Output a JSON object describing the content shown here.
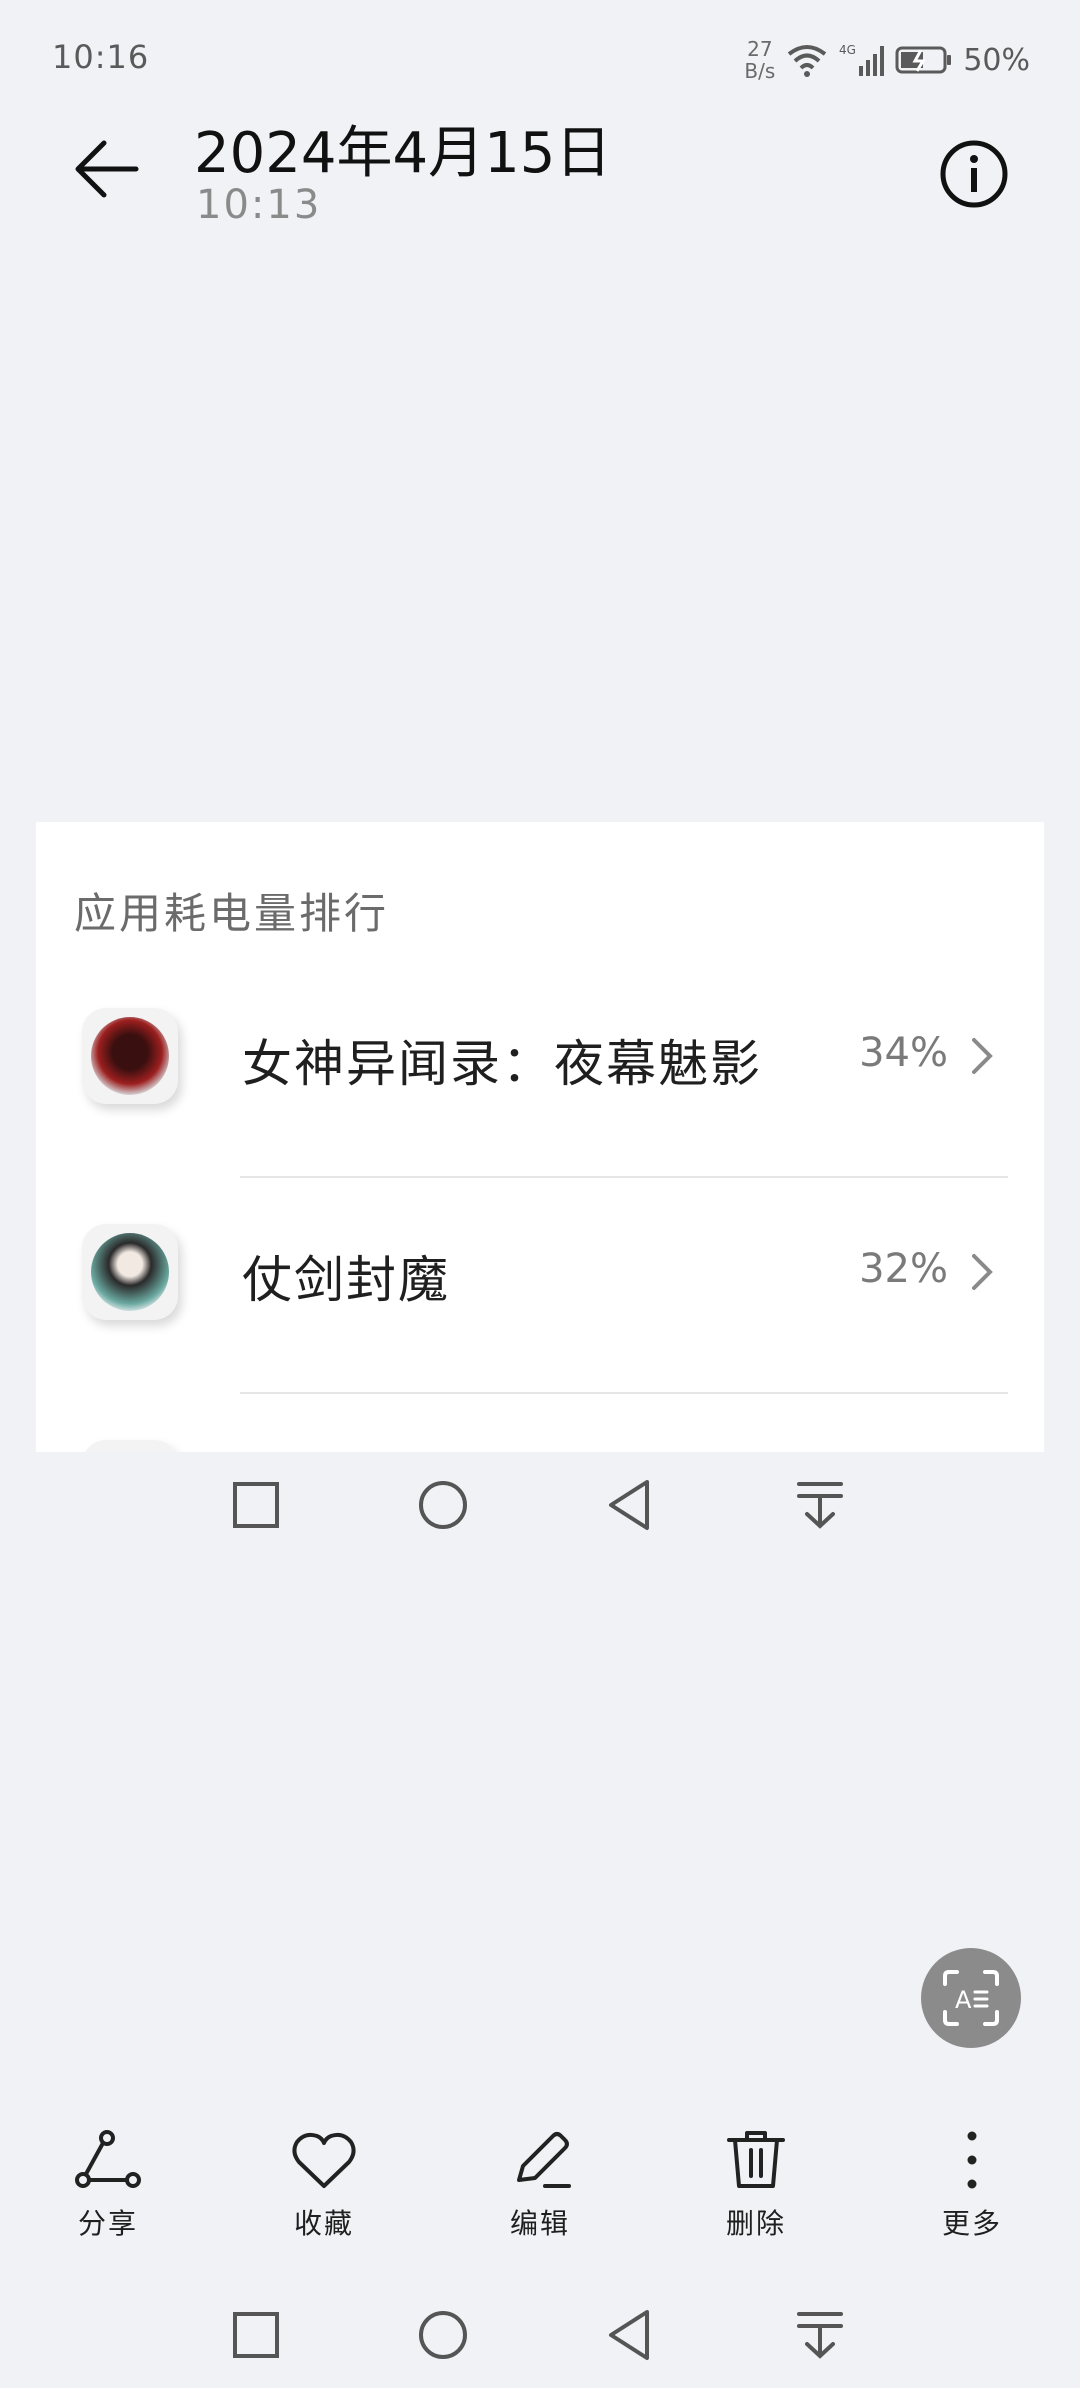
{
  "status": {
    "time": "10:16",
    "net_speed_value": "27",
    "net_speed_unit": "B/s",
    "battery": "50%"
  },
  "header": {
    "date": "2024年4月15日",
    "time": "10:13"
  },
  "screenshot": {
    "section_title": "应用耗电量排行",
    "apps": [
      {
        "name": "女神异闻录：夜幕魅影",
        "percent": "34%"
      },
      {
        "name": "仗剑封魔",
        "percent": "32%"
      }
    ]
  },
  "actions": [
    {
      "label": "分享"
    },
    {
      "label": "收藏"
    },
    {
      "label": "编辑"
    },
    {
      "label": "删除"
    },
    {
      "label": "更多"
    }
  ]
}
